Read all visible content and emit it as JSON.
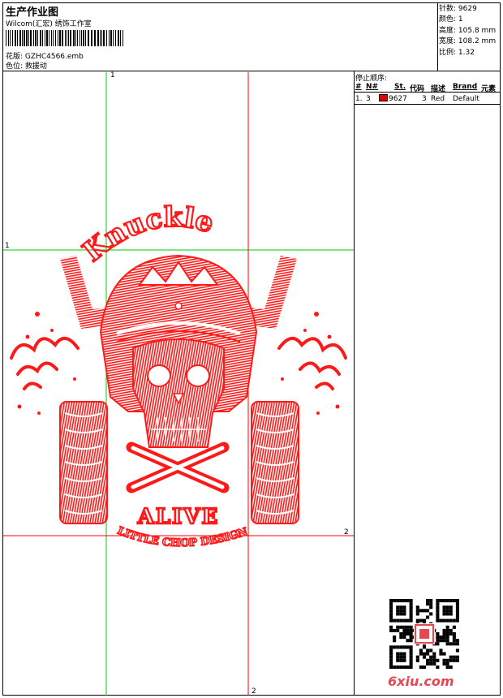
{
  "header": {
    "title": "生产作业图",
    "company": "Wilcom(汇宏) 绣饰工作室",
    "pattern_label": "花版:",
    "pattern_value": "GZHC4566.emb",
    "position_label": "色位:",
    "position_value": "救援动"
  },
  "stats": [
    {
      "label": "针数:",
      "value": "9629"
    },
    {
      "label": "颜色:",
      "value": "1"
    },
    {
      "label": "高度:",
      "value": "105.8 mm"
    },
    {
      "label": "宽度:",
      "value": "108.2 mm"
    },
    {
      "label": "比例:",
      "value": "1.32"
    }
  ],
  "stop_sequence": {
    "title": "停止顺序:",
    "columns": [
      "#",
      "N#",
      "St.",
      "代码",
      "描述",
      "Brand",
      "元素"
    ],
    "rows": [
      {
        "index": "1.",
        "needle": "3",
        "stitches": "9627",
        "code": "3",
        "description": "Red",
        "brand": "Default",
        "element": "",
        "color": "#e00000"
      }
    ]
  },
  "guides": {
    "top": "1",
    "left": "1",
    "right": "2",
    "bottom": "2"
  },
  "design": {
    "headline": "Knuckle",
    "slogan": "ALIVE",
    "tagline": "LITTLE CHOP DESIGN",
    "color": "#ff1a1a"
  },
  "watermark": "6xiu.com",
  "colors": {
    "guide_green": "#00cc00",
    "guide_red": "#ff0000",
    "thread": "#ff1a1a"
  }
}
